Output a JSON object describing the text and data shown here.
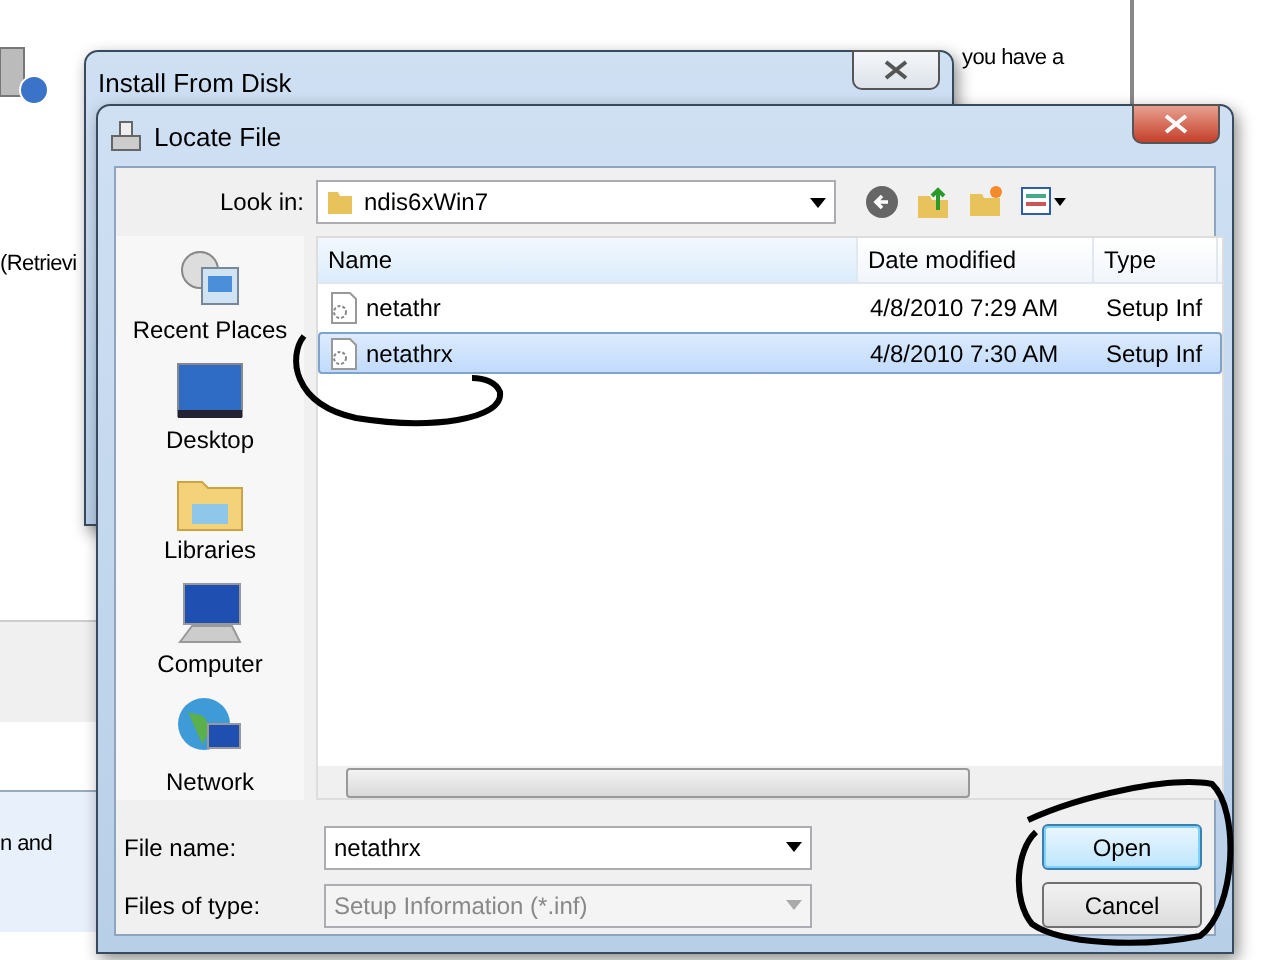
{
  "background_window": {
    "texts": [
      "you have a",
      "(Retrievi",
      "n and"
    ]
  },
  "install_dialog": {
    "title": "Install From Disk"
  },
  "locate_dialog": {
    "title": "Locate File",
    "look_in": {
      "label": "Look in:",
      "value": "ndis6xWin7"
    },
    "places": [
      {
        "label": "Recent Places",
        "kind": "recent"
      },
      {
        "label": "Desktop",
        "kind": "desktop"
      },
      {
        "label": "Libraries",
        "kind": "libraries"
      },
      {
        "label": "Computer",
        "kind": "computer"
      },
      {
        "label": "Network",
        "kind": "network"
      }
    ],
    "columns": [
      "Name",
      "Date modified",
      "Type"
    ],
    "rows": [
      {
        "name": "netathr",
        "date": "4/8/2010 7:29 AM",
        "type": "Setup Inf",
        "selected": false
      },
      {
        "name": "netathrx",
        "date": "4/8/2010 7:30 AM",
        "type": "Setup Inf",
        "selected": true
      }
    ],
    "file_name": {
      "label": "File name:",
      "value": "netathrx"
    },
    "file_type": {
      "label": "Files of type:",
      "value": "Setup Information (*.inf)",
      "disabled": true
    },
    "buttons": [
      {
        "label": "Open",
        "default": true
      },
      {
        "label": "Cancel",
        "default": false
      }
    ]
  }
}
